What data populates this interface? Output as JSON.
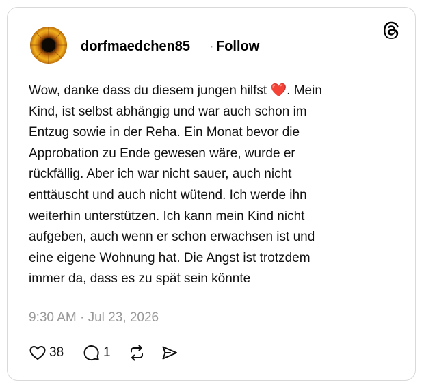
{
  "post": {
    "username": "dorfmaedchen85",
    "separator": "·",
    "follow_label": "Follow",
    "body_lines": [
      "Wow, danke dass du diesem jungen hilfst",
      ". Mein",
      "Kind, ist selbst abhängig und war auch schon im",
      "Entzug sowie in der Reha. Ein Monat bevor die",
      "Approbation zu Ende gewesen wäre, wurde er",
      "rückfällig. Aber ich war nicht sauer, auch nicht",
      "enttäuscht und auch nicht wütend. Ich werde ihn",
      "weiterhin unterstützen. Ich kann mein Kind nicht",
      "aufgeben, auch wenn er schon erwachsen ist und",
      "eine eigene Wohnung hat. Die Angst ist trotzdem",
      "immer da, dass es zu spät sein könnte"
    ],
    "emoji": "❤️",
    "timestamp": "9:30 AM · Jul 23, 2026"
  },
  "actions": {
    "like": {
      "icon": "heart-icon",
      "count": "38"
    },
    "reply": {
      "icon": "comment-icon",
      "count": "1"
    },
    "repost": {
      "icon": "repost-icon"
    },
    "share": {
      "icon": "share-icon"
    }
  },
  "colors": {
    "text": "#111111",
    "muted": "#999999",
    "border": "#d9d9d9",
    "emoji_heart": "#e8222a"
  }
}
